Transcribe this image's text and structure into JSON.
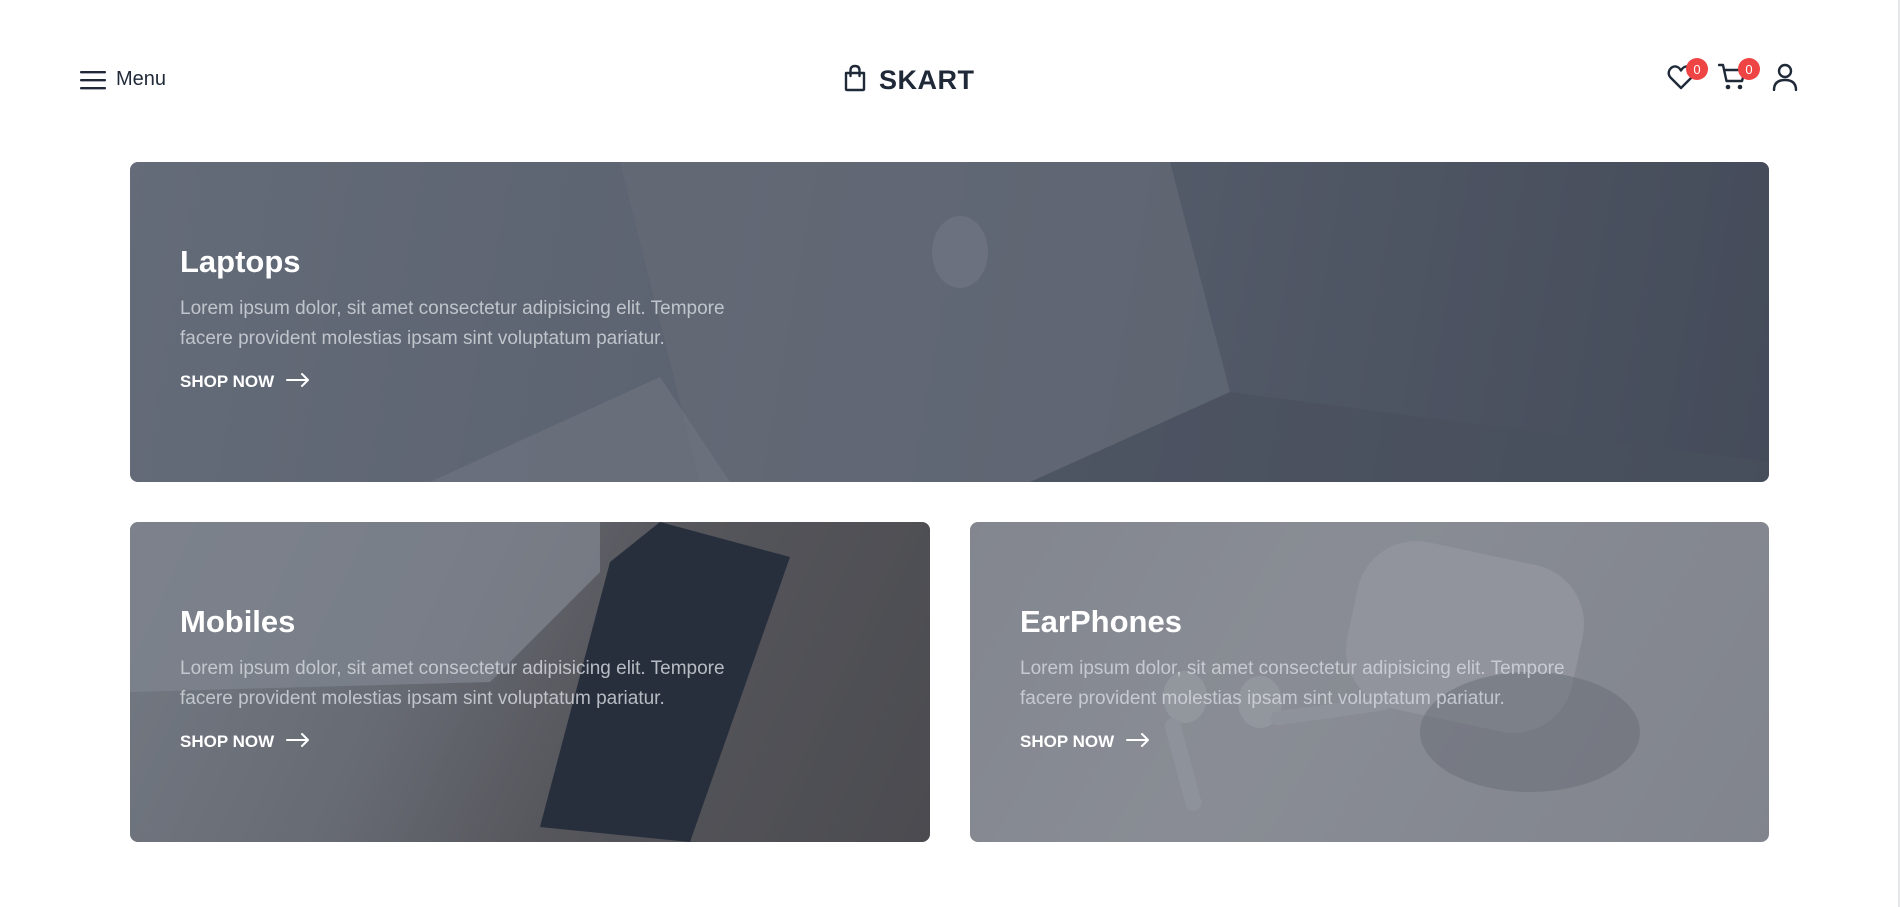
{
  "header": {
    "menu_label": "Menu",
    "logo_text": "SKART",
    "wishlist_count": "0",
    "cart_count": "0"
  },
  "colors": {
    "badge": "#ef4444",
    "text_dark": "#1f2937"
  },
  "icons": {
    "menu": "hamburger-icon",
    "logo": "shopping-bag-icon",
    "wishlist": "heart-icon",
    "cart": "cart-icon",
    "account": "user-icon",
    "shop_arrow": "arrow-right-icon"
  },
  "categories": [
    {
      "title": "Laptops",
      "description": "Lorem ipsum dolor, sit amet consectetur adipisicing elit. Tempore facere provident molestias ipsam sint voluptatum pariatur.",
      "cta": "SHOP NOW"
    },
    {
      "title": "Mobiles",
      "description": "Lorem ipsum dolor, sit amet consectetur adipisicing elit. Tempore facere provident molestias ipsam sint voluptatum pariatur.",
      "cta": "SHOP NOW"
    },
    {
      "title": "EarPhones",
      "description": "Lorem ipsum dolor, sit amet consectetur adipisicing elit. Tempore facere provident molestias ipsam sint voluptatum pariatur.",
      "cta": "SHOP NOW"
    }
  ]
}
